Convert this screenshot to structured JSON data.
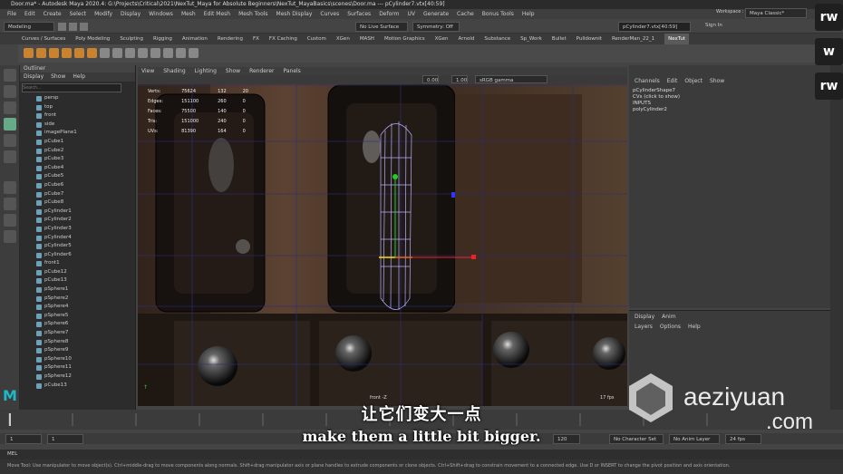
{
  "window": {
    "title": "Door.ma* - Autodesk Maya 2020.4: G:\\Projects\\Critical\\2021\\NexTut_Maya for Absolute Beginners\\NexTut_MayaBasics\\scenes\\Door.ma  ---  pCylinder7.vtx[40:59]"
  },
  "menubar": [
    "File",
    "Edit",
    "Create",
    "Select",
    "Modify",
    "Display",
    "Windows",
    "Mesh",
    "Edit Mesh",
    "Mesh Tools",
    "Mesh Display",
    "Curves",
    "Surfaces",
    "Deform",
    "UV",
    "Generate",
    "Cache",
    "Bonus Tools",
    "Help"
  ],
  "status": {
    "mode": "Modeling",
    "live": "No Live Surface",
    "symmetry": "Symmetry: Off",
    "selection_field": "pCylinder7.vtx[40:59]",
    "signin": "Sign In",
    "workspace_label": "Workspace :",
    "workspace": "Maya Classic*"
  },
  "shelf_tabs": [
    "Curves / Surfaces",
    "Poly Modeling",
    "Sculpting",
    "Rigging",
    "Animation",
    "Rendering",
    "FX",
    "FX Caching",
    "Custom",
    "XGen",
    "MASH",
    "Motion Graphics",
    "XGen",
    "Arnold",
    "Substance",
    "Sp_Work",
    "Bullet",
    "Pulldownit",
    "RenderMan_22_1",
    "NexTut"
  ],
  "outliner": {
    "title": "Outliner",
    "menu": [
      "Display",
      "Show",
      "Help"
    ],
    "search_placeholder": "Search...",
    "items": [
      "persp",
      "top",
      "front",
      "side",
      "imagePlane1",
      "pCube1",
      "pCube2",
      "pCube3",
      "pCube4",
      "pCube5",
      "pCube6",
      "pCube7",
      "pCube8",
      "pCylinder1",
      "pCylinder2",
      "pCylinder3",
      "pCylinder4",
      "pCylinder5",
      "pCylinder6",
      "front1",
      "pCube12",
      "pCube13",
      "pSphere1",
      "pSphere2",
      "pSphere4",
      "pSphere5",
      "pSphere6",
      "pSphere7",
      "pSphere8",
      "pSphere9",
      "pSphere10",
      "pSphere11",
      "pSphere12",
      "pCube13"
    ]
  },
  "viewport": {
    "menu": [
      "View",
      "Shading",
      "Lighting",
      "Show",
      "Renderer",
      "Panels"
    ],
    "camera": "front -Z",
    "fps": "17 fps",
    "exposure": "0.00",
    "gamma": "1.00",
    "color_space": "sRGB gamma",
    "hud": [
      [
        "Verts:",
        "75624",
        "132",
        "20"
      ],
      [
        "Edges:",
        "151100",
        "260",
        "0"
      ],
      [
        "Faces:",
        "75500",
        "140",
        "0"
      ],
      [
        "Tris:",
        "151000",
        "240",
        "0"
      ],
      [
        "UVs:",
        "81390",
        "164",
        "0"
      ]
    ]
  },
  "channelbox": {
    "menu": [
      "Channels",
      "Edit",
      "Object",
      "Show"
    ],
    "items": [
      "pCylinderShape7",
      "CVs (click to show)",
      "INPUTS",
      "polyCylinder2"
    ]
  },
  "layers": {
    "tabs": [
      "Display",
      "Anim"
    ],
    "menu": [
      "Layers",
      "Options",
      "Help"
    ]
  },
  "timeline": {
    "start": "1",
    "end": "120",
    "current": "1",
    "character_set": "No Character Set",
    "anim_layer": "No Anim Layer",
    "fps": "24 fps"
  },
  "mel": {
    "label": "MEL"
  },
  "help_line": "Move Tool: Use manipulator to move object(s). Ctrl+middle-drag to move components along normals. Shift+drag manipulator axis or plane handles to extrude components or clone objects. Ctrl+Shift+drag to constrain movement to a connected edge. Use D or INSERT to change the pivot position and axis orientation.",
  "subtitles": {
    "cn": "让它们变大一点",
    "en": "make them a little bit bigger."
  },
  "watermark": {
    "brand": "aeziyuan",
    "tld": ".com",
    "badge": "rw",
    "badge2": "w"
  }
}
